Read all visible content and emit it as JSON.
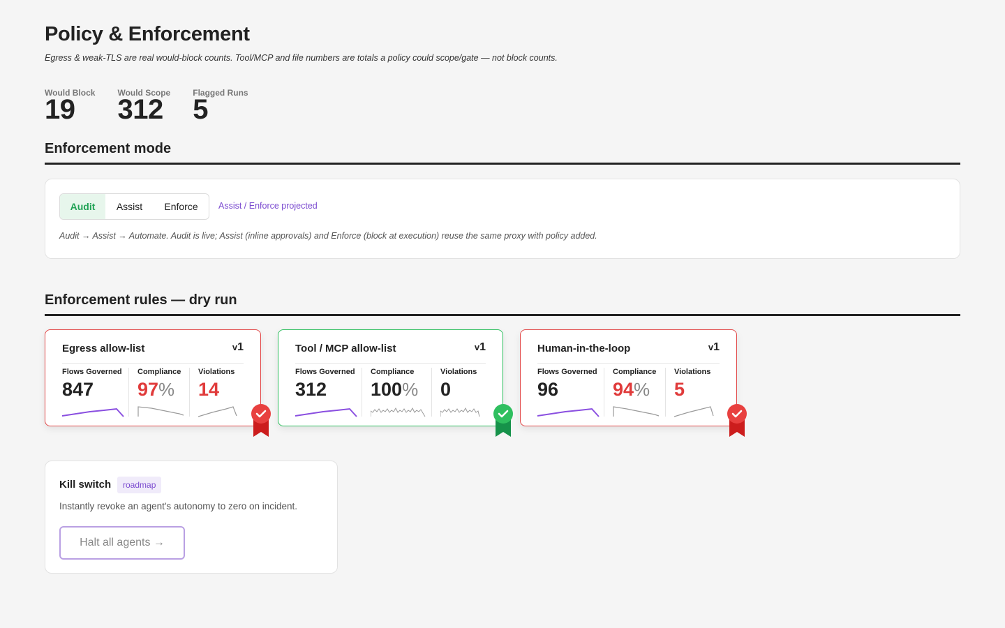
{
  "header": {
    "title": "Policy & Enforcement",
    "subtitle": "Egress & weak-TLS are real would-block counts. Tool/MCP and file numbers are totals a policy could scope/gate — not block counts."
  },
  "stats": [
    {
      "label": "Would Block",
      "value": "19"
    },
    {
      "label": "Would Scope",
      "value": "312"
    },
    {
      "label": "Flagged Runs",
      "value": "5"
    }
  ],
  "enforcement_mode": {
    "section_title": "Enforcement mode",
    "options": [
      "Audit",
      "Assist",
      "Enforce"
    ],
    "selected": "Audit",
    "projected_link": "Assist / Enforce projected",
    "note": "Audit → Assist → Automate. Audit is live; Assist (inline approvals) and Enforce (block at execution) reuse the same proxy with policy added."
  },
  "rules_section": {
    "title": "Enforcement rules — dry run",
    "rules": [
      {
        "name": "Egress allow-list",
        "version_prefix": "v",
        "version": "1",
        "status": "fail",
        "flows_label": "Flows Governed",
        "flows": "847",
        "compliance_label": "Compliance",
        "compliance": "97",
        "compliance_unit": "%",
        "violations_label": "Violations",
        "violations": "14"
      },
      {
        "name": "Tool / MCP allow-list",
        "version_prefix": "v",
        "version": "1",
        "status": "pass",
        "flows_label": "Flows Governed",
        "flows": "312",
        "compliance_label": "Compliance",
        "compliance": "100",
        "compliance_unit": "%",
        "violations_label": "Violations",
        "violations": "0"
      },
      {
        "name": "Human-in-the-loop",
        "version_prefix": "v",
        "version": "1",
        "status": "fail",
        "flows_label": "Flows Governed",
        "flows": "96",
        "compliance_label": "Compliance",
        "compliance": "94",
        "compliance_unit": "%",
        "violations_label": "Violations",
        "violations": "5"
      }
    ]
  },
  "kill_switch": {
    "title": "Kill switch",
    "badge": "roadmap",
    "description": "Instantly revoke an agent's autonomy to zero on incident.",
    "button_label": "Halt all agents →"
  },
  "colors": {
    "pass": "#2fbf5f",
    "fail": "#e24848",
    "accent": "#7b4bd0",
    "sparkline_flows": "#8a4fe0",
    "sparkline_other": "#9a9a9a"
  }
}
